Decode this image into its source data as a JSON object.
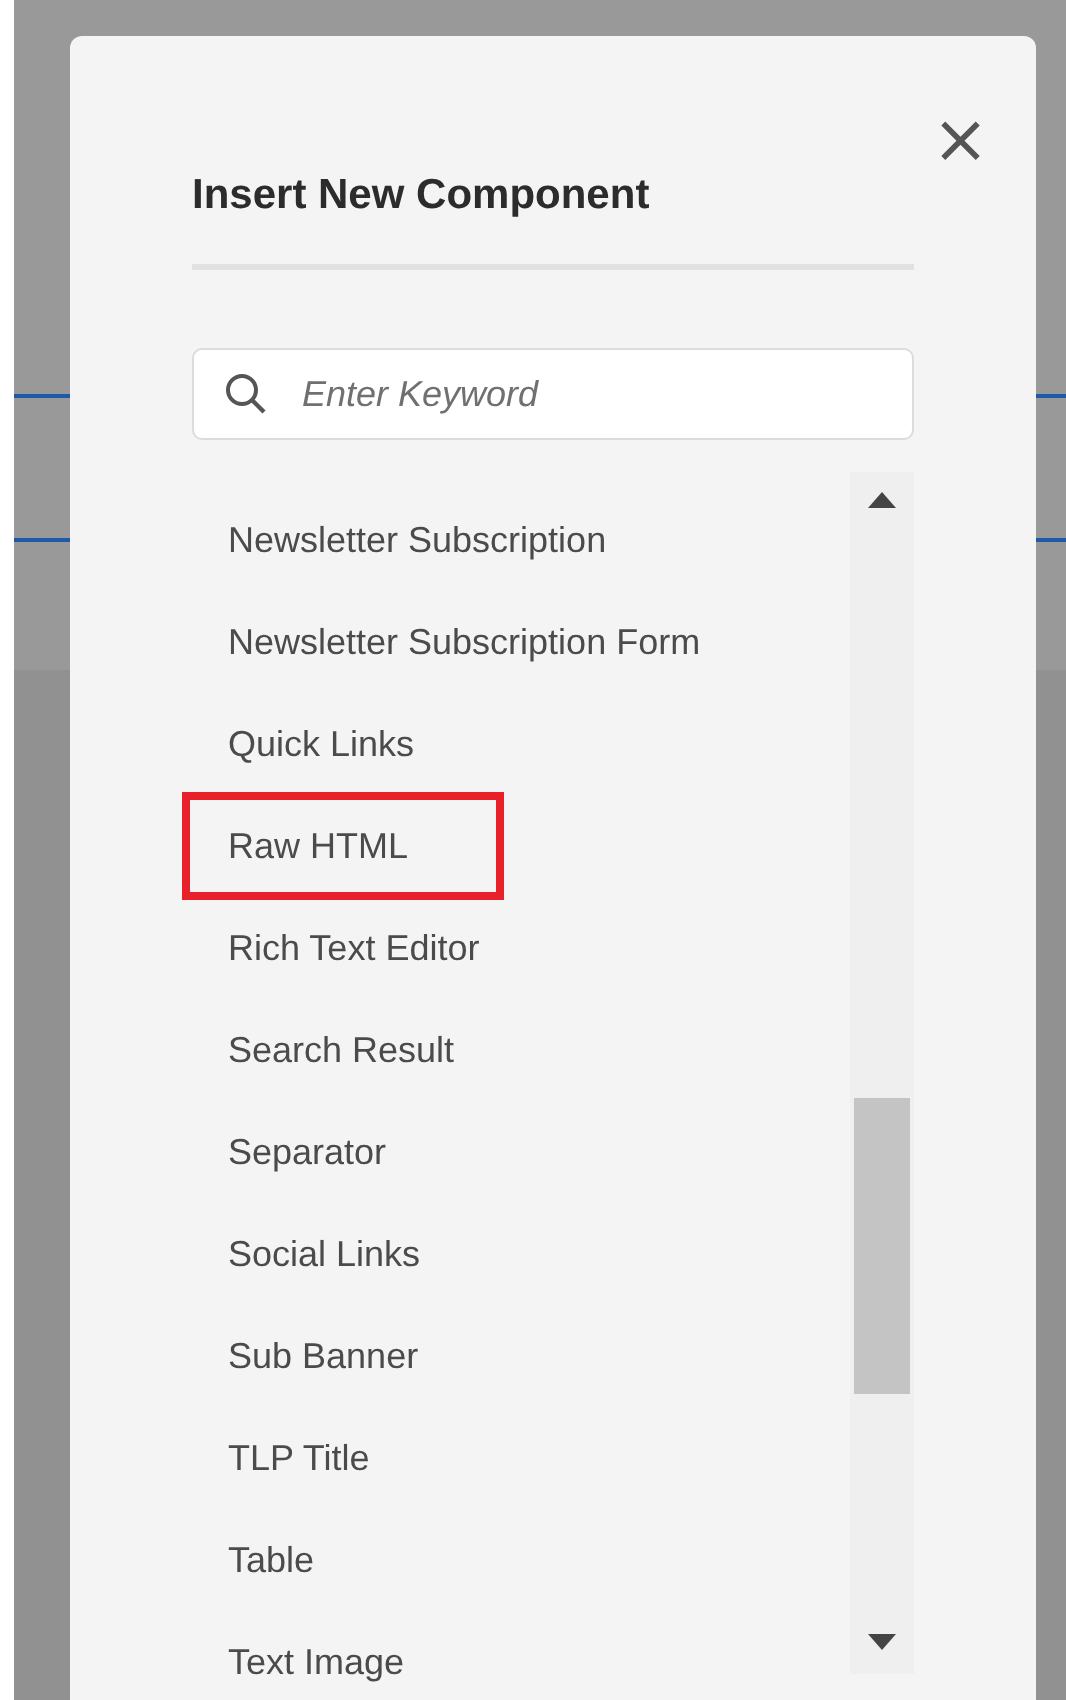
{
  "dialog": {
    "title": "Insert New Component",
    "close_label": "×",
    "search": {
      "placeholder": "Enter Keyword"
    },
    "items": [
      {
        "label": "Newsletter Subscription",
        "highlighted": false
      },
      {
        "label": "Newsletter Subscription Form",
        "highlighted": false
      },
      {
        "label": "Quick Links",
        "highlighted": false
      },
      {
        "label": "Raw HTML",
        "highlighted": true
      },
      {
        "label": "Rich Text Editor",
        "highlighted": false
      },
      {
        "label": "Search Result",
        "highlighted": false
      },
      {
        "label": "Separator",
        "highlighted": false
      },
      {
        "label": "Social Links",
        "highlighted": false
      },
      {
        "label": "Sub Banner",
        "highlighted": false
      },
      {
        "label": "TLP Title",
        "highlighted": false
      },
      {
        "label": "Table",
        "highlighted": false
      },
      {
        "label": "Text Image",
        "highlighted": false
      }
    ]
  }
}
